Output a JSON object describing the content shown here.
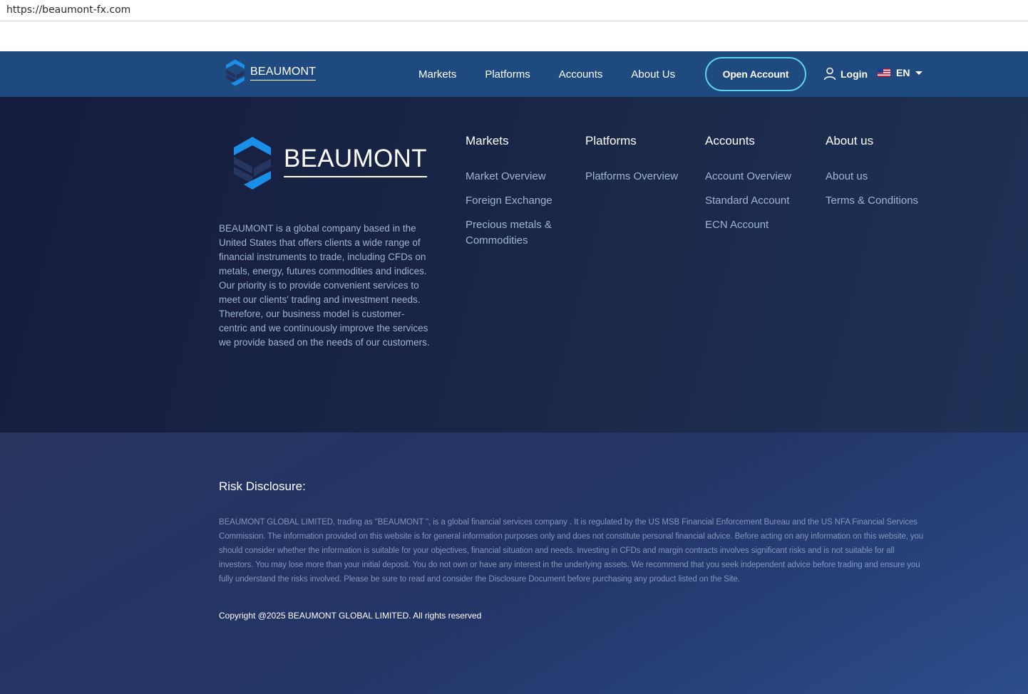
{
  "browser": {
    "url": "https://beaumont-fx.com"
  },
  "colors": {
    "nav_bg": "#1f4a7f",
    "accent": "#5ad3ea",
    "logo_blue": "#1a8fe8",
    "footer_bg": "#161c3e"
  },
  "header": {
    "brand": "BEAUMONT",
    "nav": [
      "Markets",
      "Platforms",
      "Accounts",
      "About Us"
    ],
    "open_account": "Open Account",
    "login": "Login",
    "language": "EN"
  },
  "footer": {
    "brand": "BEAUMONT",
    "about_text": "BEAUMONT is a global company based in the United States that offers clients a wide range of financial instruments to trade, including CFDs on metals, energy, futures commodities and indices. Our priority is to provide convenient services to meet our clients' trading and investment needs. Therefore, our business model is customer-centric and we continuously improve the services we provide based on the needs of our customers.",
    "columns": [
      {
        "title": "Markets",
        "links": [
          "Market Overview",
          "Foreign Exchange",
          "Precious metals & Commodities"
        ]
      },
      {
        "title": "Platforms",
        "links": [
          "Platforms Overview"
        ]
      },
      {
        "title": "Accounts",
        "links": [
          "Account Overview",
          "Standard Account",
          "ECN Account"
        ]
      },
      {
        "title": "About us",
        "links": [
          "About us",
          "Terms & Conditions"
        ]
      }
    ],
    "risk_title": "Risk Disclosure:",
    "risk_text": "BEAUMONT GLOBAL LIMITED, trading as \"BEAUMONT \", is a global financial services company . It is regulated by the US MSB Financial Enforcement Bureau and the US NFA Financial Services Commission. The information provided on this website is for general information purposes only and does not constitute personal financial advice. Before acting on any information on this website, you should consider whether the information is suitable for your objectives, financial situation and needs. Investing in CFDs and margin contracts involves significant risks and is not suitable for all investors. You may lose more than your initial deposit. You do not own or have any interest in the underlying assets. We recommend that you seek independent advice before trading and ensure you fully understand the risks involved. Please be sure to read and consider the Disclosure Document before purchasing any product listed on the Site.",
    "copyright": "Copyright @2025 BEAUMONT GLOBAL LIMITED. All rights reserved"
  }
}
